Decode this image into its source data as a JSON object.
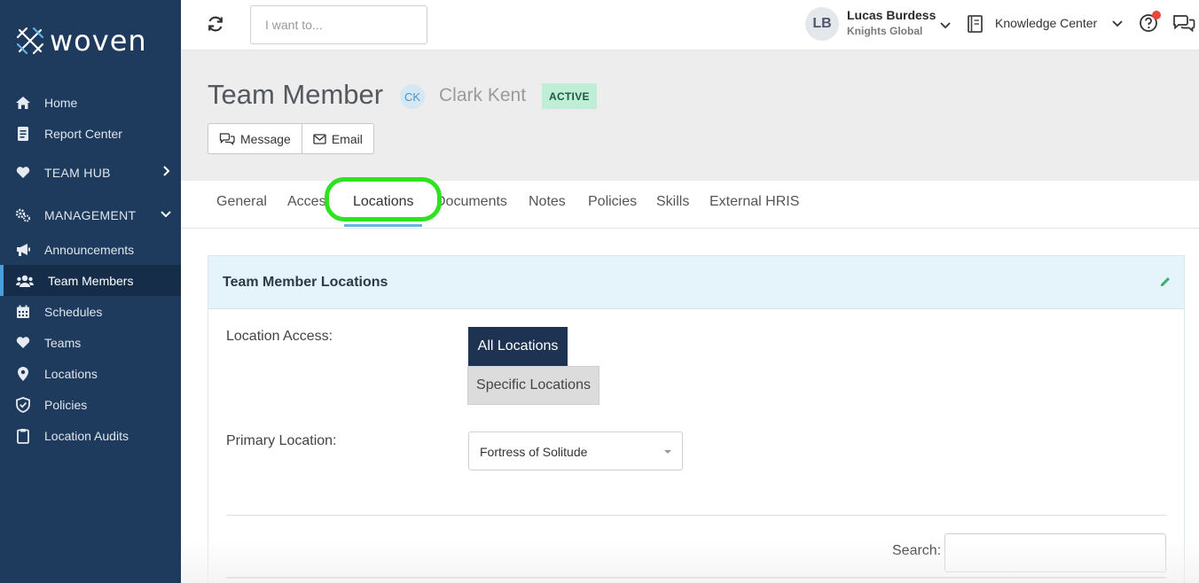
{
  "app": {
    "logo_text": "woven"
  },
  "sidebar": {
    "items": [
      {
        "label": "Home",
        "icon": "home-icon"
      },
      {
        "label": "Report Center",
        "icon": "report-icon"
      },
      {
        "label": "TEAM HUB",
        "icon": "heart-icon",
        "section": true
      },
      {
        "label": "MANAGEMENT",
        "icon": "cogs-icon",
        "section": true
      },
      {
        "label": "Announcements",
        "icon": "megaphone-icon"
      },
      {
        "label": "Team Members",
        "icon": "users-icon",
        "active": true
      },
      {
        "label": "Schedules",
        "icon": "calendar-icon"
      },
      {
        "label": "Teams",
        "icon": "heart-icon"
      },
      {
        "label": "Locations",
        "icon": "map-pin-icon"
      },
      {
        "label": "Policies",
        "icon": "shield-icon"
      },
      {
        "label": "Location Audits",
        "icon": "clipboard-icon"
      }
    ]
  },
  "topbar": {
    "search_placeholder": "I want to...",
    "user": {
      "initials": "LB",
      "name": "Lucas Burdess",
      "org": "Knights Global"
    },
    "knowledge_center": "Knowledge Center"
  },
  "header": {
    "title": "Team Member",
    "initials": "CK",
    "member_name": "Clark Kent",
    "status": "ACTIVE",
    "status_color": "#bfeed6",
    "buttons": {
      "message": "Message",
      "email": "Email"
    }
  },
  "tabs": [
    {
      "label": "General"
    },
    {
      "label": "Access"
    },
    {
      "label": "Locations",
      "active": true
    },
    {
      "label": "Documents"
    },
    {
      "label": "Notes"
    },
    {
      "label": "Policies"
    },
    {
      "label": "Skills"
    },
    {
      "label": "External HRIS"
    }
  ],
  "panel": {
    "title": "Team Member Locations",
    "location_access_label": "Location Access:",
    "options": {
      "all": "All Locations",
      "specific": "Specific Locations"
    },
    "primary_location_label": "Primary Location:",
    "primary_location_value": "Fortress of Solitude",
    "search_label": "Search:"
  },
  "colors": {
    "sidebar_bg": "#1e3a5c",
    "highlight": "#2ee21f",
    "accent": "#69b4de"
  }
}
